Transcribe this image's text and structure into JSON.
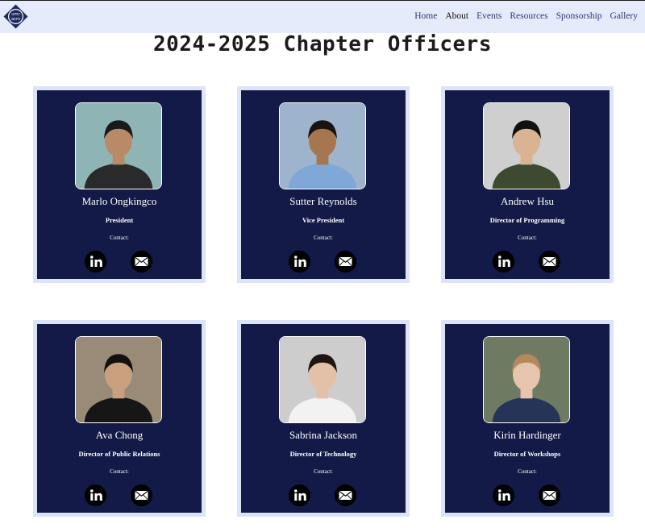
{
  "nav": {
    "logo_text": [
      "umr",
      "acm"
    ],
    "links": [
      {
        "label": "Home",
        "active": false
      },
      {
        "label": "About",
        "active": true
      },
      {
        "label": "Events",
        "active": false
      },
      {
        "label": "Resources",
        "active": false
      },
      {
        "label": "Sponsorship",
        "active": false
      },
      {
        "label": "Gallery",
        "active": false
      }
    ]
  },
  "page": {
    "title": "2024-2025 Chapter Officers"
  },
  "colors": {
    "nav_bg": "#e6ebfb",
    "card_border": "#dde4f8",
    "card_bg": "#131a48"
  },
  "officers": [
    {
      "name": "Marlo Ongkingco",
      "role": "President",
      "contact_label": "Contact:",
      "photo_bg": "#8fb4b6",
      "shirt": "#2a2a2a",
      "skin": "#b88a68",
      "hair": "#1a1a1a"
    },
    {
      "name": "Sutter Reynolds",
      "role": "Vice President",
      "contact_label": "Contact:",
      "photo_bg": "#9db4cc",
      "shirt": "#7fa8d8",
      "skin": "#a67650",
      "hair": "#1a1410"
    },
    {
      "name": "Andrew Hsu",
      "role": "Director of Programming",
      "contact_label": "Contact:",
      "photo_bg": "#cfcfcf",
      "shirt": "#3d4a30",
      "skin": "#d9b393",
      "hair": "#111111"
    },
    {
      "name": "Ava Chong",
      "role": "Director of Public Relations",
      "contact_label": "Contact:",
      "photo_bg": "#9a8a78",
      "shirt": "#161616",
      "skin": "#c9a07e",
      "hair": "#151010"
    },
    {
      "name": "Sabrina Jackson",
      "role": "Director of Technology",
      "contact_label": "Contact:",
      "photo_bg": "#cdcdcd",
      "shirt": "#f2f2f2",
      "skin": "#e3c0a8",
      "hair": "#1e1410"
    },
    {
      "name": "Kirin Hardinger",
      "role": "Director of Workshops",
      "contact_label": "Contact:",
      "photo_bg": "#6e7a62",
      "shirt": "#263458",
      "skin": "#e6c4ad",
      "hair": "#b48a5c"
    }
  ]
}
